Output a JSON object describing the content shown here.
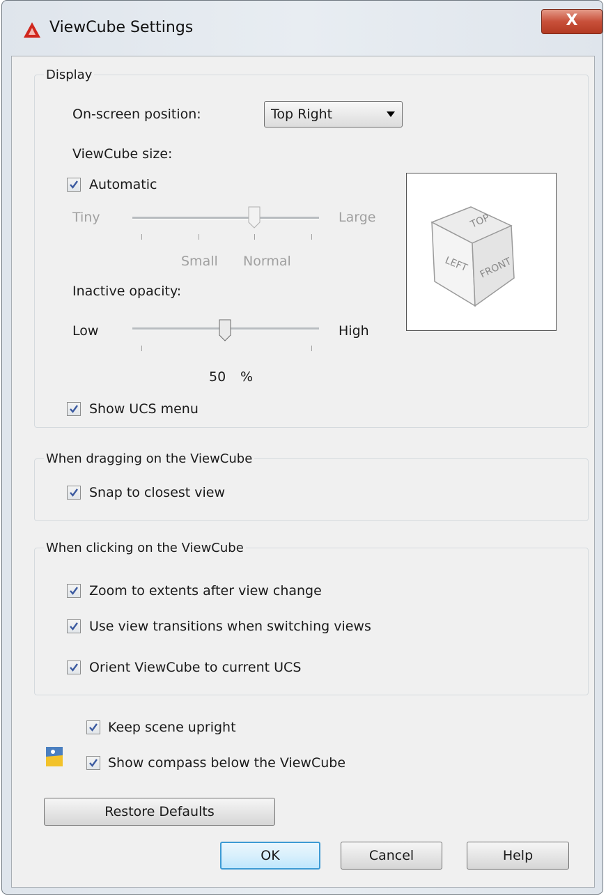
{
  "window": {
    "title": "ViewCube Settings",
    "close_glyph": "X"
  },
  "display": {
    "group_title": "Display",
    "position_label": "On-screen position:",
    "position_value": "Top Right",
    "size_label": "ViewCube size:",
    "automatic_label": "Automatic",
    "automatic_checked": true,
    "size_slider": {
      "min_label": "Tiny",
      "max_label": "Large",
      "tick_labels": [
        "Small",
        "Normal"
      ],
      "level": "Normal",
      "enabled": false
    },
    "opacity_label": "Inactive opacity:",
    "opacity_slider": {
      "min_label": "Low",
      "max_label": "High",
      "value": 50
    },
    "opacity_value": "50",
    "opacity_unit": "%",
    "show_ucs_label": "Show UCS menu",
    "show_ucs_checked": true,
    "preview_faces": {
      "top": "TOP",
      "left": "LEFT",
      "front": "FRONT"
    }
  },
  "dragging": {
    "group_title": "When dragging on the ViewCube",
    "snap_label": "Snap to closest view",
    "snap_checked": true
  },
  "clicking": {
    "group_title": "When clicking on the ViewCube",
    "zoom_label": "Zoom to extents after view change",
    "transitions_label": "Use view transitions when switching views",
    "orient_label": "Orient ViewCube to current UCS"
  },
  "misc": {
    "upright_label": "Keep scene upright",
    "compass_label": "Show compass below the ViewCube"
  },
  "buttons": {
    "restore": "Restore Defaults",
    "ok": "OK",
    "cancel": "Cancel",
    "help": "Help"
  },
  "colors": {
    "accent_default_button": "#3c9ad4",
    "check_mark": "#3b5aa0",
    "close_button": "#c8503a"
  }
}
